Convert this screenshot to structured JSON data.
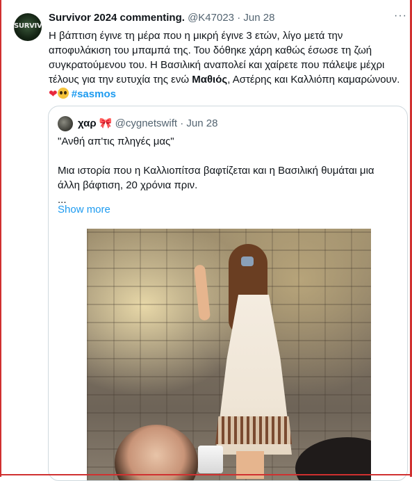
{
  "tweet": {
    "avatar_text": "SURVIVO",
    "author_name": "Survivor 2024 commenting.",
    "handle": "@K47023",
    "separator": "·",
    "date": "Jun 28",
    "more_icon": "more-horizontal-icon",
    "lines": [
      "Η βάπτιση έγινε τη μέρα που η μικρή έγινε 3 ετών, λίγο μετά την",
      "αποφυλάκιση του μπαμπά της. Του δόθηκε χάρη καθώς έσωσε τη ζωή",
      "συγκρατούμενου του. Η Βασιλική αναπολεί και χαίρετε που πάλεψε μέχρι"
    ],
    "line4_pre": "τέλους για την ευτυχία της ενώ ",
    "line4_bold": "Μαθιός",
    "line4_post": ", Αστέρης και Καλλιόπη καμαρώνουν.",
    "emoji_heart": "❤",
    "emoji_face": "pleading-face-icon",
    "hashtag": "#sasmos"
  },
  "quote": {
    "author_name": "χαρ",
    "author_emoji": "🎀",
    "handle": "@cygnetswift",
    "separator": "·",
    "date": "Jun 28",
    "line1": "\"Ανθή απ'τις πληγές μας\"",
    "line2": "Μια ιστορία που η Καλλιοπίτσα βαφτίζεται και η Βασιλική θυμάται μια",
    "line3": "άλλη βάφτιση, 20 χρόνια πριν.",
    "line4": "...",
    "show_more": "Show more",
    "photo_description_icon": "photo-girl-in-white-dress"
  },
  "colors": {
    "link": "#1d9bf0",
    "muted": "#536471",
    "border": "#cfd9de",
    "frame": "#d03030"
  }
}
